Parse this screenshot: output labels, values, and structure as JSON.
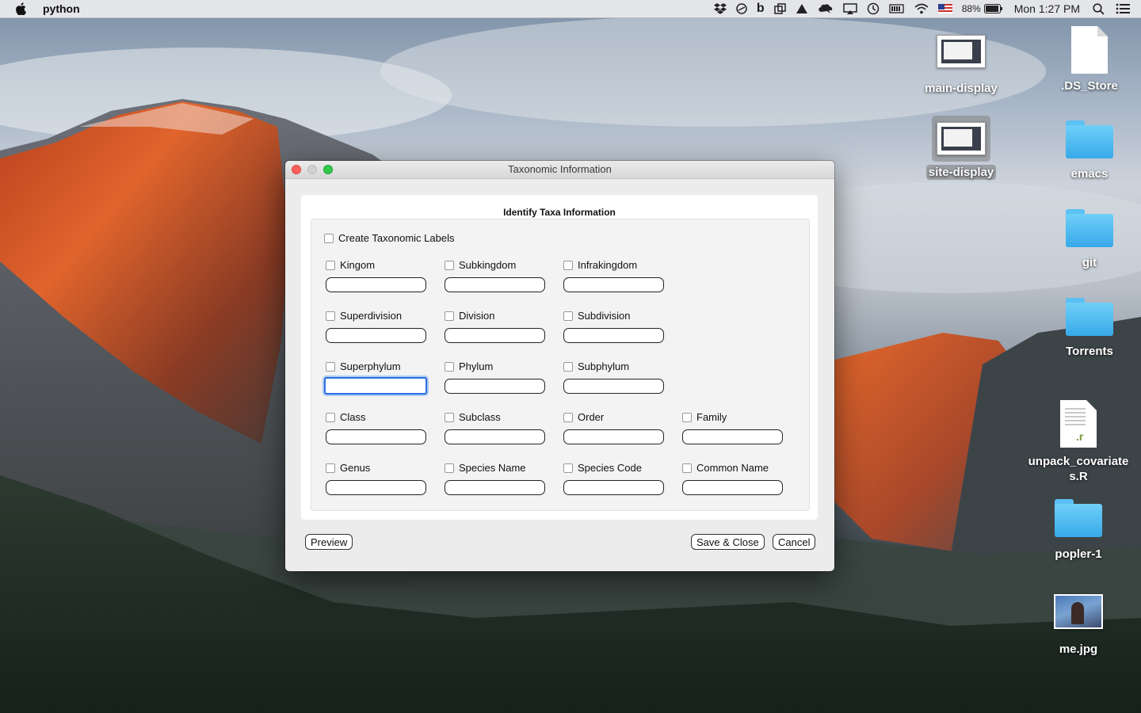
{
  "menubar": {
    "app_name": "python",
    "battery": "88%",
    "clock": "Mon 1:27 PM",
    "icons": [
      "apple-icon",
      "dropbox-icon",
      "circle-icon",
      "b-icon",
      "sync-icon",
      "drive-icon",
      "cloud-icon",
      "airplay-icon",
      "time-machine-icon",
      "battery-icon",
      "wifi-icon",
      "flag-icon",
      "spotlight-icon",
      "list-icon"
    ]
  },
  "desktop": {
    "icons": [
      {
        "label": "main-display"
      },
      {
        "label": ".DS_Store"
      },
      {
        "label": "site-display"
      },
      {
        "label": "emacs"
      },
      {
        "label": "git"
      },
      {
        "label": "Torrents"
      },
      {
        "label": "unpack_covariates.R",
        "line1": "unpack_covariate",
        "line2": "s.R",
        "ext": ".r"
      },
      {
        "label": "popler-1"
      },
      {
        "label": "me.jpg"
      }
    ]
  },
  "window": {
    "title": "Taxonomic Information",
    "group_title": "Identify Taxa Information",
    "master_checkbox": "Create Taxonomic Labels",
    "fields": {
      "kingom": "Kingom",
      "subkingdom": "Subkingdom",
      "infrakingdom": "Infrakingdom",
      "superdivision": "Superdivision",
      "division": "Division",
      "subdivision": "Subdivision",
      "superphylum": "Superphylum",
      "phylum": "Phylum",
      "subphylum": "Subphylum",
      "class": "Class",
      "subclass": "Subclass",
      "order": "Order",
      "family": "Family",
      "genus": "Genus",
      "species_name": "Species Name",
      "species_code": "Species Code",
      "common_name": "Common Name"
    },
    "buttons": {
      "preview": "Preview",
      "save_close": "Save & Close",
      "cancel": "Cancel"
    }
  }
}
